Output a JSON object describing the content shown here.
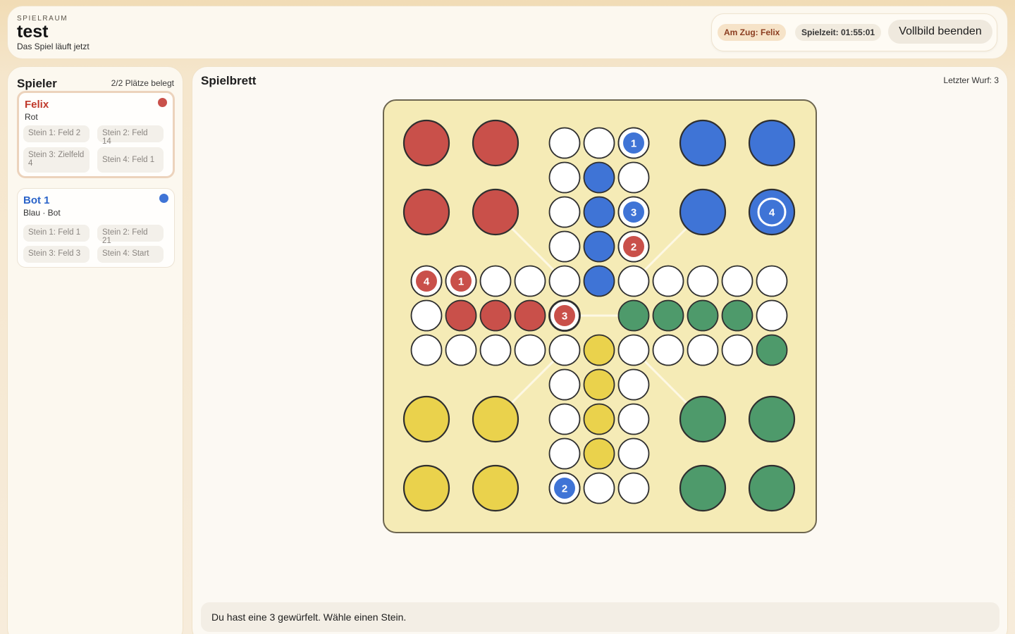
{
  "header": {
    "eyebrow": "SPIELRAUM",
    "title": "test",
    "subtitle": "Das Spiel läuft jetzt",
    "turn_label": "Am Zug: Felix",
    "time_label": "Spielzeit: 01:55:01",
    "exit_label": "Vollbild beenden"
  },
  "sidebar": {
    "title": "Spieler",
    "count": "2/2 Plätze belegt",
    "players": [
      {
        "name": "Felix",
        "subtitle": "Rot",
        "color": "#c9504a",
        "name_color": "#c0392b",
        "active": true,
        "stones": [
          "Stein 1: Feld 2",
          "Stein 2: Feld 14",
          "Stein 3: Zielfeld 4",
          "Stein 4: Feld 1"
        ]
      },
      {
        "name": "Bot 1",
        "subtitle": "Blau · Bot",
        "color": "#3f74d6",
        "name_color": "#2a63c9",
        "active": false,
        "stones": [
          "Stein 1: Feld 1",
          "Stein 2: Feld 21",
          "Stein 3: Feld 3",
          "Stein 4: Start"
        ]
      }
    ]
  },
  "main": {
    "title": "Spielbrett",
    "last_roll": "Letzter Wurf: 3",
    "status": "Du hast eine 3 gewürfelt. Wähle einen Stein."
  },
  "colors": {
    "red": "#c9504a",
    "blue": "#3f74d6",
    "yellow": "#ead24c",
    "green": "#4e9a6b",
    "white": "#ffffff",
    "board": "#f5ebb6",
    "outline": "#2f2f2f"
  },
  "board": {
    "bases": [
      {
        "color": "red",
        "cells": [
          [
            0,
            0
          ],
          [
            0,
            2
          ],
          [
            2,
            0
          ],
          [
            2,
            2
          ]
        ]
      },
      {
        "color": "blue",
        "cells": [
          [
            0,
            8
          ],
          [
            0,
            10
          ],
          [
            2,
            8
          ],
          [
            2,
            10
          ]
        ]
      },
      {
        "color": "yellow",
        "cells": [
          [
            8,
            0
          ],
          [
            8,
            2
          ],
          [
            10,
            0
          ],
          [
            10,
            2
          ]
        ]
      },
      {
        "color": "green",
        "cells": [
          [
            8,
            8
          ],
          [
            8,
            10
          ],
          [
            10,
            8
          ],
          [
            10,
            10
          ]
        ]
      }
    ],
    "fields": [
      {
        "r": 0,
        "c": 4,
        "f": "white"
      },
      {
        "r": 0,
        "c": 5,
        "f": "white"
      },
      {
        "r": 0,
        "c": 6,
        "f": "white"
      },
      {
        "r": 1,
        "c": 4,
        "f": "white"
      },
      {
        "r": 1,
        "c": 5,
        "f": "blue"
      },
      {
        "r": 1,
        "c": 6,
        "f": "white"
      },
      {
        "r": 2,
        "c": 4,
        "f": "white"
      },
      {
        "r": 2,
        "c": 5,
        "f": "blue"
      },
      {
        "r": 2,
        "c": 6,
        "f": "white"
      },
      {
        "r": 3,
        "c": 4,
        "f": "white"
      },
      {
        "r": 3,
        "c": 5,
        "f": "blue"
      },
      {
        "r": 3,
        "c": 6,
        "f": "white"
      },
      {
        "r": 4,
        "c": 0,
        "f": "white"
      },
      {
        "r": 4,
        "c": 1,
        "f": "white"
      },
      {
        "r": 4,
        "c": 2,
        "f": "white"
      },
      {
        "r": 4,
        "c": 3,
        "f": "white"
      },
      {
        "r": 4,
        "c": 4,
        "f": "white"
      },
      {
        "r": 4,
        "c": 5,
        "f": "blue"
      },
      {
        "r": 4,
        "c": 6,
        "f": "white"
      },
      {
        "r": 4,
        "c": 7,
        "f": "white"
      },
      {
        "r": 4,
        "c": 8,
        "f": "white"
      },
      {
        "r": 4,
        "c": 9,
        "f": "white"
      },
      {
        "r": 4,
        "c": 10,
        "f": "white"
      },
      {
        "r": 5,
        "c": 0,
        "f": "white"
      },
      {
        "r": 5,
        "c": 1,
        "f": "red"
      },
      {
        "r": 5,
        "c": 2,
        "f": "red"
      },
      {
        "r": 5,
        "c": 3,
        "f": "red"
      },
      {
        "r": 5,
        "c": 4,
        "f": "white"
      },
      {
        "r": 5,
        "c": 6,
        "f": "green"
      },
      {
        "r": 5,
        "c": 7,
        "f": "green"
      },
      {
        "r": 5,
        "c": 8,
        "f": "green"
      },
      {
        "r": 5,
        "c": 9,
        "f": "green"
      },
      {
        "r": 5,
        "c": 10,
        "f": "white"
      },
      {
        "r": 6,
        "c": 0,
        "f": "white"
      },
      {
        "r": 6,
        "c": 1,
        "f": "white"
      },
      {
        "r": 6,
        "c": 2,
        "f": "white"
      },
      {
        "r": 6,
        "c": 3,
        "f": "white"
      },
      {
        "r": 6,
        "c": 4,
        "f": "white"
      },
      {
        "r": 6,
        "c": 5,
        "f": "yellow"
      },
      {
        "r": 6,
        "c": 6,
        "f": "white"
      },
      {
        "r": 6,
        "c": 7,
        "f": "white"
      },
      {
        "r": 6,
        "c": 8,
        "f": "white"
      },
      {
        "r": 6,
        "c": 9,
        "f": "white"
      },
      {
        "r": 6,
        "c": 10,
        "f": "green"
      },
      {
        "r": 7,
        "c": 4,
        "f": "white"
      },
      {
        "r": 7,
        "c": 5,
        "f": "yellow"
      },
      {
        "r": 7,
        "c": 6,
        "f": "white"
      },
      {
        "r": 8,
        "c": 4,
        "f": "white"
      },
      {
        "r": 8,
        "c": 5,
        "f": "yellow"
      },
      {
        "r": 8,
        "c": 6,
        "f": "white"
      },
      {
        "r": 9,
        "c": 4,
        "f": "white"
      },
      {
        "r": 9,
        "c": 5,
        "f": "yellow"
      },
      {
        "r": 9,
        "c": 6,
        "f": "white"
      },
      {
        "r": 10,
        "c": 4,
        "f": "white"
      },
      {
        "r": 10,
        "c": 5,
        "f": "white"
      },
      {
        "r": 10,
        "c": 6,
        "f": "white"
      }
    ],
    "pieces": [
      {
        "r": 0,
        "c": 6,
        "color": "blue",
        "label": "1",
        "owner": "blue"
      },
      {
        "r": 2,
        "c": 6,
        "color": "blue",
        "label": "3",
        "owner": "blue"
      },
      {
        "r": 3,
        "c": 6,
        "color": "red",
        "label": "2",
        "owner": "red"
      },
      {
        "r": 4,
        "c": 0,
        "color": "red",
        "label": "4",
        "owner": "red"
      },
      {
        "r": 4,
        "c": 1,
        "color": "red",
        "label": "1",
        "owner": "red"
      },
      {
        "r": 5,
        "c": 4,
        "color": "red",
        "label": "3",
        "owner": "red",
        "selected": true
      },
      {
        "r": 10,
        "c": 4,
        "color": "blue",
        "label": "2",
        "owner": "blue"
      },
      {
        "r": 2,
        "c": 10,
        "color": "blue",
        "label": "4",
        "owner": "blue",
        "home": true
      }
    ]
  }
}
